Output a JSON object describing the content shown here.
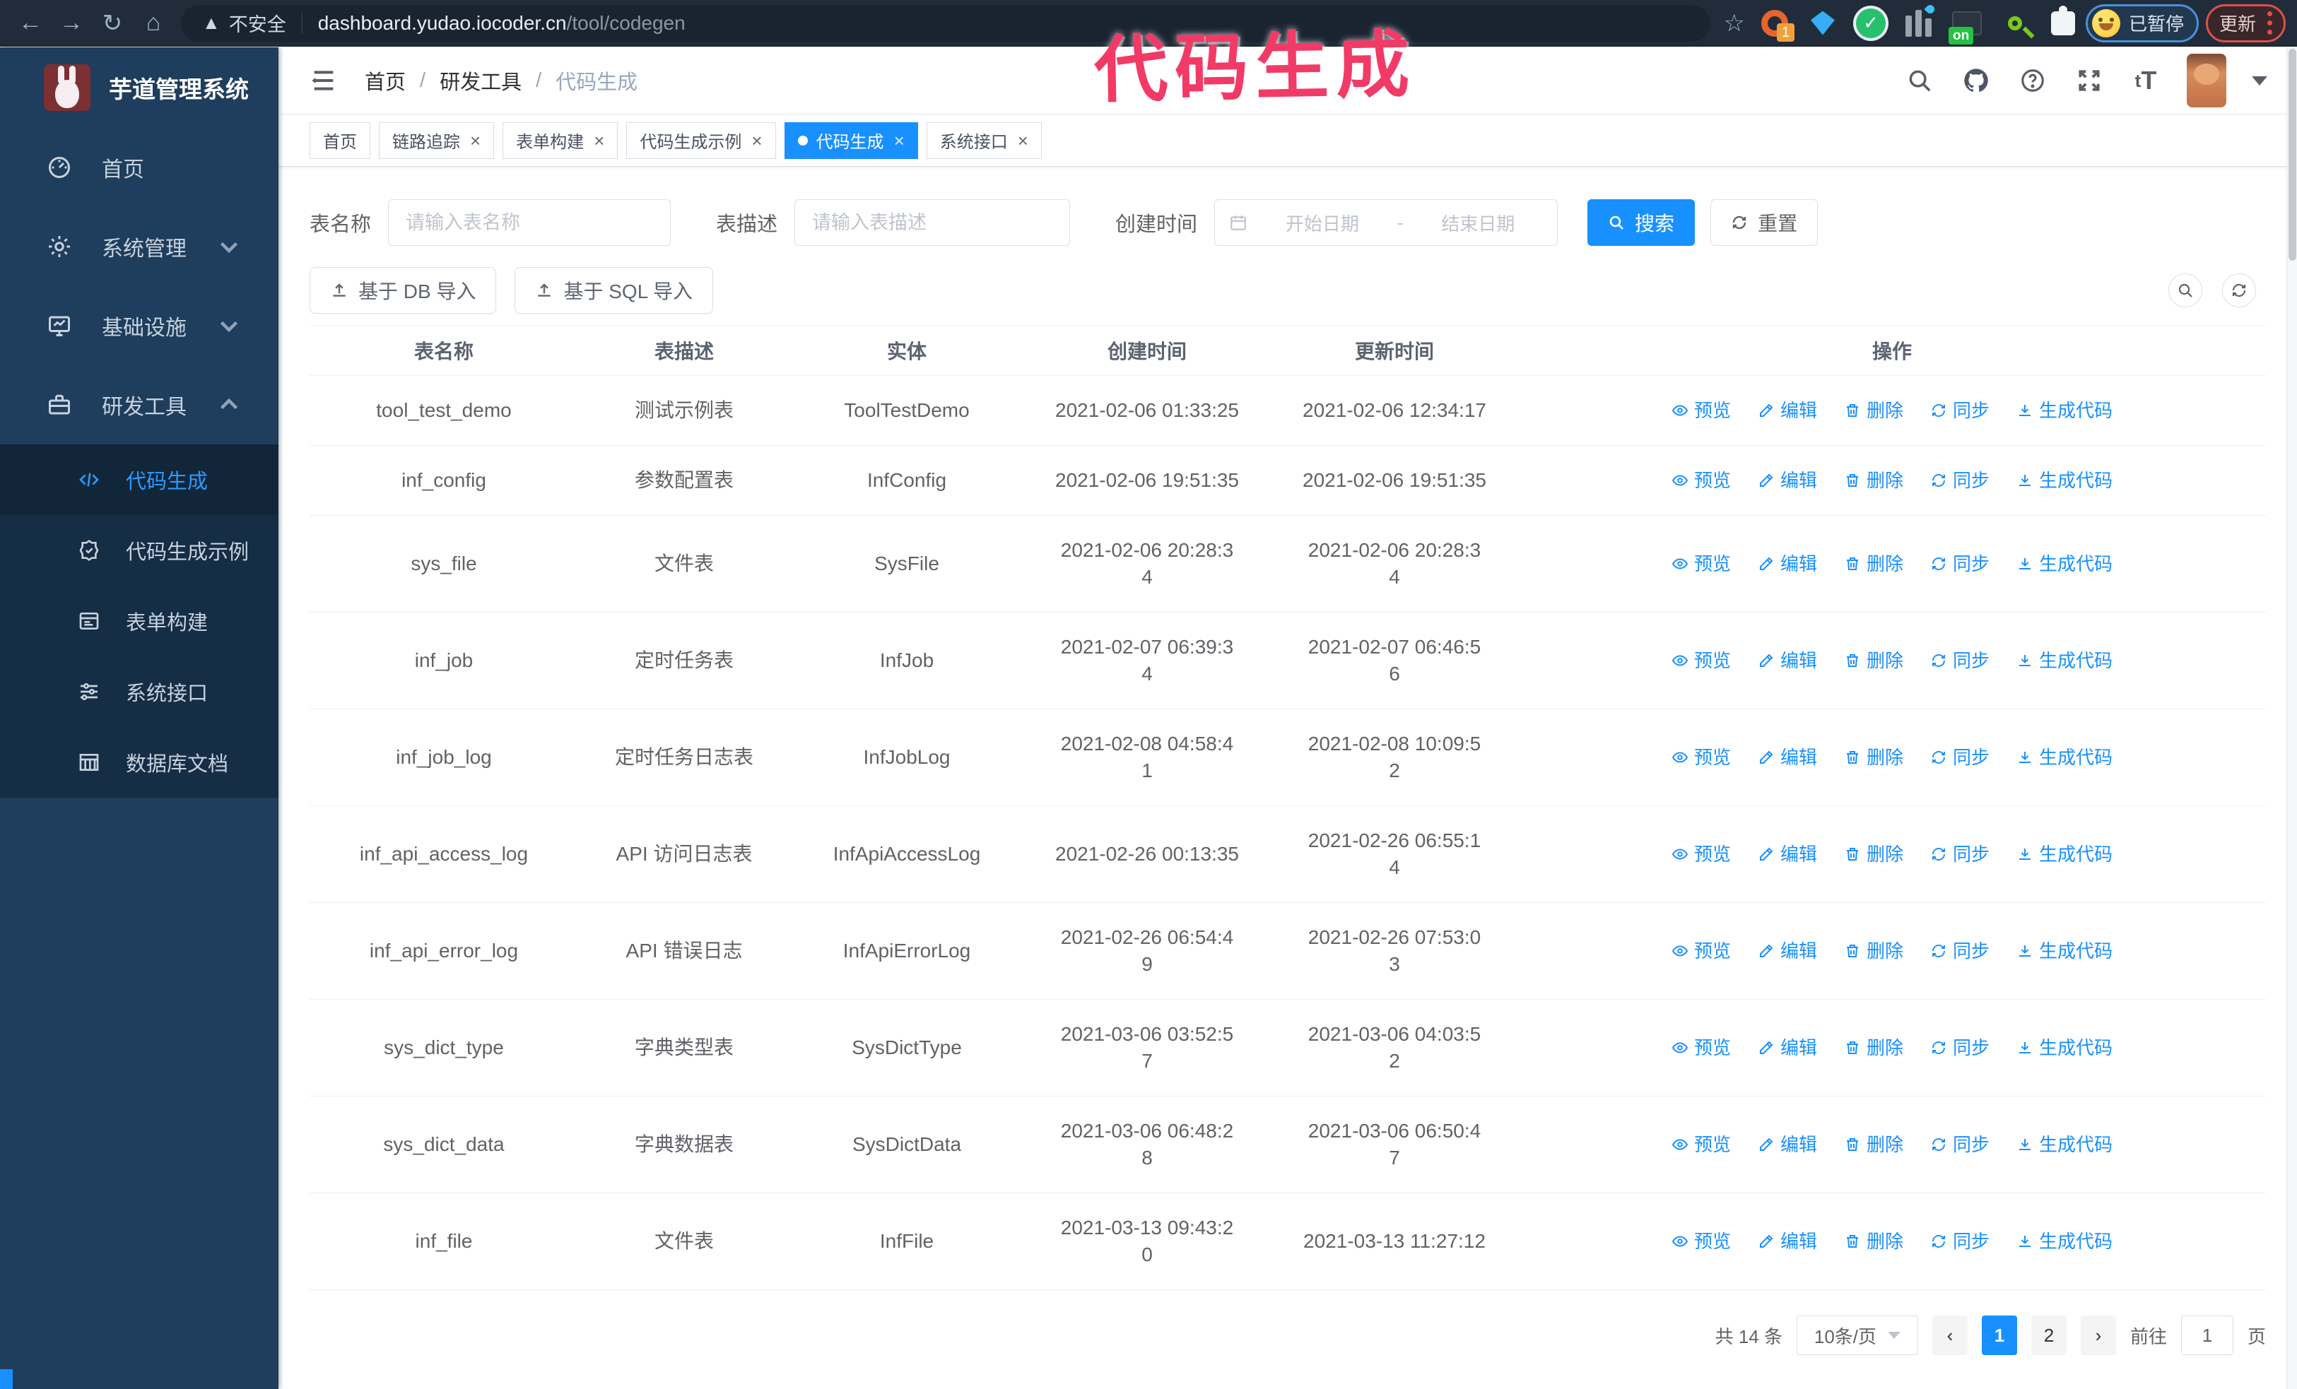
{
  "browser": {
    "security_label": "不安全",
    "url_host": "dashboard.yudao.iocoder.cn",
    "url_path": "/tool/codegen",
    "extension_badge": "1",
    "on_badge": "on",
    "paused_chip": "已暂停",
    "update_chip": "更新"
  },
  "annotation": {
    "text": "代码生成",
    "color": "#f23a67"
  },
  "sidebar": {
    "title": "芋道管理系统",
    "menu": [
      {
        "label": "首页",
        "icon": "dashboard-icon",
        "has_children": false,
        "expanded": false
      },
      {
        "label": "系统管理",
        "icon": "gear-icon",
        "has_children": true,
        "expanded": false
      },
      {
        "label": "基础设施",
        "icon": "monitor-icon",
        "has_children": true,
        "expanded": false
      },
      {
        "label": "研发工具",
        "icon": "toolbox-icon",
        "has_children": true,
        "expanded": true
      }
    ],
    "submenu": [
      {
        "label": "代码生成",
        "icon": "code-icon",
        "active": true
      },
      {
        "label": "代码生成示例",
        "icon": "badge-check-icon",
        "active": false
      },
      {
        "label": "表单构建",
        "icon": "form-icon",
        "active": false
      },
      {
        "label": "系统接口",
        "icon": "sliders-icon",
        "active": false
      },
      {
        "label": "数据库文档",
        "icon": "database-icon",
        "active": false
      }
    ]
  },
  "breadcrumb": {
    "items": [
      "首页",
      "研发工具",
      "代码生成"
    ],
    "separator": "/"
  },
  "tabs": [
    {
      "label": "首页",
      "closable": false,
      "active": false
    },
    {
      "label": "链路追踪",
      "closable": true,
      "active": false
    },
    {
      "label": "表单构建",
      "closable": true,
      "active": false
    },
    {
      "label": "代码生成示例",
      "closable": true,
      "active": false
    },
    {
      "label": "代码生成",
      "closable": true,
      "active": true
    },
    {
      "label": "系统接口",
      "closable": true,
      "active": false
    }
  ],
  "filters": {
    "name_label": "表名称",
    "name_placeholder": "请输入表名称",
    "desc_label": "表描述",
    "desc_placeholder": "请输入表描述",
    "time_label": "创建时间",
    "start_placeholder": "开始日期",
    "range_separator": "-",
    "end_placeholder": "结束日期",
    "search_label": "搜索",
    "reset_label": "重置"
  },
  "toolbar": {
    "import_db_label": "基于 DB 导入",
    "import_sql_label": "基于 SQL 导入"
  },
  "table": {
    "columns": [
      "表名称",
      "表描述",
      "实体",
      "创建时间",
      "更新时间",
      "操作"
    ],
    "ops": {
      "preview": "预览",
      "edit": "编辑",
      "delete": "删除",
      "sync": "同步",
      "generate": "生成代码"
    },
    "rows": [
      {
        "name": "tool_test_demo",
        "desc": "测试示例表",
        "entity": "ToolTestDemo",
        "created": "2021-02-06 01:33:25",
        "updated": "2021-02-06 12:34:17"
      },
      {
        "name": "inf_config",
        "desc": "参数配置表",
        "entity": "InfConfig",
        "created": "2021-02-06 19:51:35",
        "updated": "2021-02-06 19:51:35"
      },
      {
        "name": "sys_file",
        "desc": "文件表",
        "entity": "SysFile",
        "created": "2021-02-06 20:28:3\n4",
        "updated": "2021-02-06 20:28:3\n4"
      },
      {
        "name": "inf_job",
        "desc": "定时任务表",
        "entity": "InfJob",
        "created": "2021-02-07 06:39:3\n4",
        "updated": "2021-02-07 06:46:5\n6"
      },
      {
        "name": "inf_job_log",
        "desc": "定时任务日志表",
        "entity": "InfJobLog",
        "created": "2021-02-08 04:58:4\n1",
        "updated": "2021-02-08 10:09:5\n2"
      },
      {
        "name": "inf_api_access_log",
        "desc": "API 访问日志表",
        "entity": "InfApiAccessLog",
        "created": "2021-02-26 00:13:35",
        "updated": "2021-02-26 06:55:1\n4"
      },
      {
        "name": "inf_api_error_log",
        "desc": "API 错误日志",
        "entity": "InfApiErrorLog",
        "created": "2021-02-26 06:54:4\n9",
        "updated": "2021-02-26 07:53:0\n3"
      },
      {
        "name": "sys_dict_type",
        "desc": "字典类型表",
        "entity": "SysDictType",
        "created": "2021-03-06 03:52:5\n7",
        "updated": "2021-03-06 04:03:5\n2"
      },
      {
        "name": "sys_dict_data",
        "desc": "字典数据表",
        "entity": "SysDictData",
        "created": "2021-03-06 06:48:2\n8",
        "updated": "2021-03-06 06:50:4\n7"
      },
      {
        "name": "inf_file",
        "desc": "文件表",
        "entity": "InfFile",
        "created": "2021-03-13 09:43:2\n0",
        "updated": "2021-03-13 11:27:12"
      }
    ]
  },
  "pagination": {
    "total_label": "共 14 条",
    "page_size_label": "10条/页",
    "pages": [
      "1",
      "2"
    ],
    "active_page": "1",
    "goto_label": "前往",
    "goto_value": "1",
    "page_unit": "页"
  },
  "icons": {
    "search-icon": "magnifier",
    "refresh-icon": "circular-arrows",
    "upload-icon": "arrow-up-tray",
    "eye-icon": "eye",
    "edit-icon": "pencil",
    "delete-icon": "trash",
    "sync-icon": "circular-arrows",
    "download-icon": "arrow-down-tray",
    "calendar-icon": "calendar",
    "github-icon": "octocat",
    "fullscreen-icon": "expand-corners",
    "help-icon": "question-circle"
  }
}
